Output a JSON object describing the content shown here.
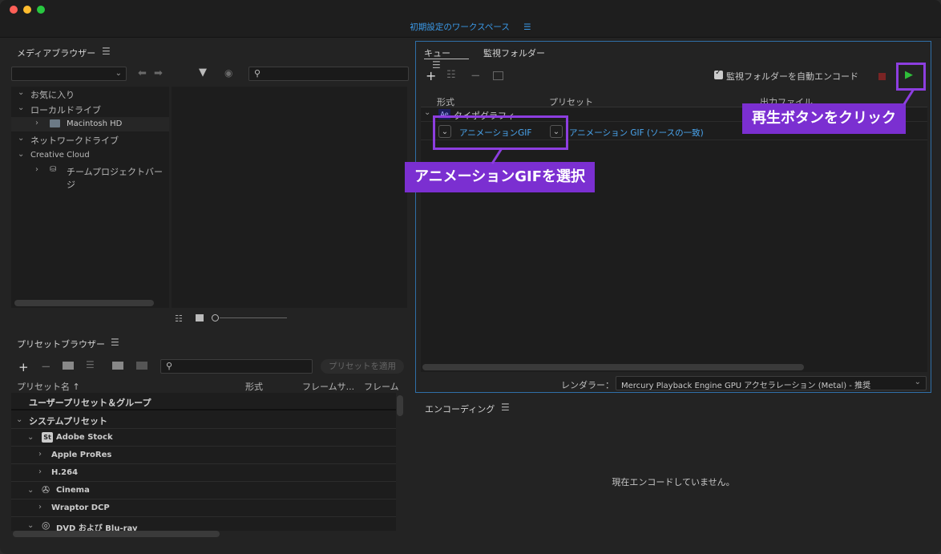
{
  "workspace": {
    "title": "初期設定のワークスペース",
    "menu_icon": "☰"
  },
  "media_browser": {
    "title": "メディアブラウザー",
    "tree": [
      {
        "label": "お気に入り",
        "level": 0
      },
      {
        "label": "ローカルドライブ",
        "level": 0
      },
      {
        "label": "Macintosh HD",
        "level": 1
      },
      {
        "label": "ネットワークドライブ",
        "level": 0
      },
      {
        "label": "Creative Cloud",
        "level": 0
      },
      {
        "label": "チームプロジェクトバージ",
        "level": 1
      }
    ]
  },
  "queue": {
    "tab_queue": "キュー",
    "tab_watch": "監視フォルダー",
    "auto_encode_label": "監視フォルダーを自動エンコード",
    "col_format": "形式",
    "col_preset": "プリセット",
    "col_output": "出力ファイル",
    "item_name": "タイポグラフィ",
    "format_value": "アニメーションGIF",
    "preset_value": "アニメーション GIF (ソースの一致)",
    "renderer_label": "レンダラー：",
    "renderer_value": "Mercury Playback Engine GPU アクセラレーション (Metal) - 推奨"
  },
  "callouts": {
    "play": "再生ボタンをクリック",
    "gif": "アニメーションGIFを選択"
  },
  "preset_browser": {
    "title": "プリセットブラウザー",
    "apply_button": "プリセットを適用",
    "col_name": "プリセット名 ↑",
    "col_format": "形式",
    "col_framesize": "フレームサ...",
    "col_framerate": "フレームレ",
    "rows": [
      {
        "label": "ユーザープリセット＆グループ"
      },
      {
        "label": "システムプリセット"
      },
      {
        "label": "Adobe Stock"
      },
      {
        "label": "Apple ProRes"
      },
      {
        "label": "H.264"
      },
      {
        "label": "Cinema"
      },
      {
        "label": "Wraptor DCP"
      },
      {
        "label": "DVD および Blu-ray"
      }
    ]
  },
  "encoding": {
    "title": "エンコーディング",
    "status": "現在エンコードしていません。"
  }
}
